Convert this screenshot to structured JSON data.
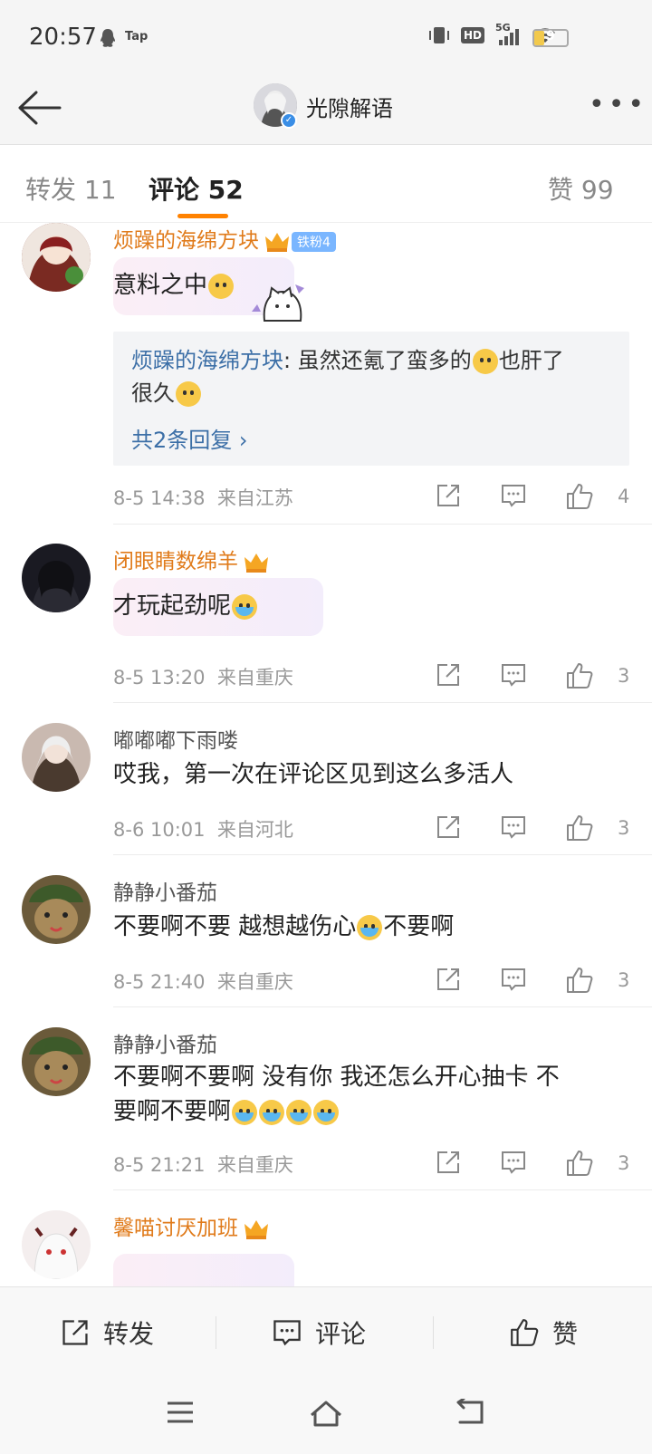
{
  "status_bar": {
    "time": "20:57",
    "tap": "Tap",
    "network": "5G",
    "hd": "HD",
    "battery": "9"
  },
  "nav": {
    "title": "光隙解语",
    "back_icon": "back-arrow-icon",
    "more_icon": "more-dots-icon"
  },
  "tabs": [
    {
      "label": "转发 11"
    },
    {
      "label": "评论 52"
    },
    {
      "label": "赞 99"
    }
  ],
  "comments": [
    {
      "user": "烦躁的海绵方块",
      "fan_badge": "铁粉4",
      "text": "意料之中",
      "reply": {
        "user": "烦躁的海绵方块",
        "text_a": ": 虽然还氪了蛮多的",
        "text_b": "也肝了",
        "text_c": "很久"
      },
      "more_replies": "共2条回复",
      "time": "8-5 14:38",
      "location": "来自江苏",
      "likes": "4"
    },
    {
      "user": "闭眼睛数绵羊",
      "text": "才玩起劲呢",
      "time": "8-5 13:20",
      "location": "来自重庆",
      "likes": "3"
    },
    {
      "user": "嘟嘟嘟下雨喽",
      "text": "哎我，第一次在评论区见到这么多活人",
      "time": "8-6 10:01",
      "location": "来自河北",
      "likes": "3"
    },
    {
      "user": "静静小番茄",
      "text_a": "不要啊不要 越想越伤心",
      "text_b": "不要啊",
      "time": "8-5 21:40",
      "location": "来自重庆",
      "likes": "3"
    },
    {
      "user": "静静小番茄",
      "text_line1": "不要啊不要啊 没有你 我还怎么开心抽卡 不",
      "text_line2": "要啊不要啊",
      "time": "8-5 21:21",
      "location": "来自重庆",
      "likes": "3"
    },
    {
      "user": "馨喵讨厌加班"
    }
  ],
  "bottom_bar": {
    "repost": "转发",
    "comment": "评论",
    "like": "赞"
  },
  "colors": {
    "accent": "#ff8200",
    "vip_name": "#e07b1b",
    "link": "#3c6fa7"
  }
}
